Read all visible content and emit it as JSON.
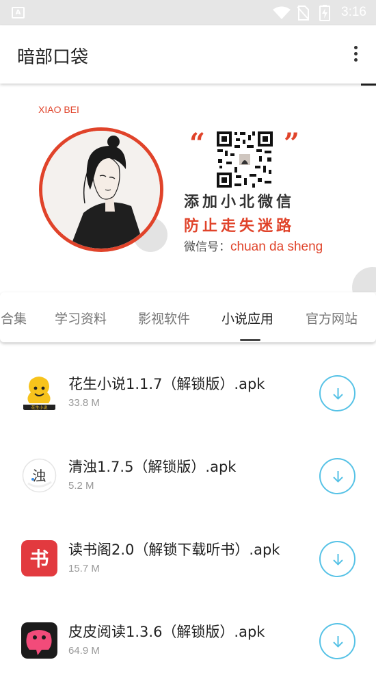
{
  "status_bar": {
    "time": "3:16",
    "notification_icon": "a-icon",
    "icons": [
      "wifi-icon",
      "no-sim-icon",
      "battery-charging-icon"
    ]
  },
  "app_bar": {
    "title": "暗部口袋",
    "menu_icon": "more-vert-icon"
  },
  "banner": {
    "name_tag": "XIAO BEI",
    "line1": "添加小北微信",
    "line2": "防止走失迷路",
    "wechat_id_label": "微信号：",
    "wechat_id_value": "chuan da sheng",
    "accent_color": "#e0432a"
  },
  "tabs": [
    {
      "label": "合集",
      "active": false
    },
    {
      "label": "学习资料",
      "active": false
    },
    {
      "label": "影视软件",
      "active": false
    },
    {
      "label": "小说应用",
      "active": true
    },
    {
      "label": "官方网站",
      "active": false
    }
  ],
  "items": [
    {
      "name": "花生小说1.1.7（解锁版）.apk",
      "size": "33.8 M",
      "icon": "peanut-novel-icon",
      "icon_text": "花生小说"
    },
    {
      "name": "清浊1.7.5（解锁版）.apk",
      "size": "5.2 M",
      "icon": "qingzhuo-icon",
      "icon_text": "浊"
    },
    {
      "name": "读书阁2.0（解锁下载听书）.apk",
      "size": "15.7 M",
      "icon": "dushuge-icon",
      "icon_text": "书"
    },
    {
      "name": "皮皮阅读1.3.6（解锁版）.apk",
      "size": "64.9 M",
      "icon": "pipi-reading-icon",
      "icon_text": ""
    }
  ],
  "colors": {
    "status_bar": "#e6e6e6",
    "download_accent": "#56c2e6",
    "tab_active": "#222222",
    "tab_inactive": "#777777"
  }
}
